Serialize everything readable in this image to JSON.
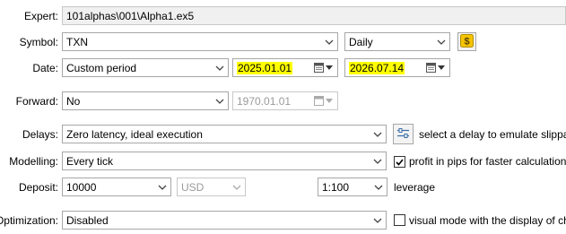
{
  "expert": {
    "label": "Expert:",
    "value": "101alphas\\001\\Alpha1.ex5"
  },
  "symbol": {
    "label": "Symbol:",
    "value": "TXN",
    "timeframe": "Daily",
    "icon": "dollar-icon"
  },
  "date": {
    "label": "Date:",
    "period": "Custom period",
    "from": "2025.01.01",
    "to": "2026.07.14"
  },
  "forward": {
    "label": "Forward:",
    "value": "No",
    "date": "1970.01.01"
  },
  "delays": {
    "label": "Delays:",
    "value": "Zero latency, ideal execution",
    "hint": "select a delay to emulate slippage a"
  },
  "modelling": {
    "label": "Modelling:",
    "value": "Every tick",
    "check_label": "profit in pips for faster calculations",
    "checked": true
  },
  "deposit": {
    "label": "Deposit:",
    "value": "10000",
    "currency": "USD",
    "leverage_value": "1:100",
    "leverage_label": "leverage"
  },
  "optimization": {
    "label": "Optimization:",
    "value": "Disabled",
    "check_label": "visual mode with the display of charts,",
    "checked": false
  },
  "colors": {
    "highlight": "#ffff00",
    "dollar_button": "#f5c400",
    "settings_button_icon": "#3a6ea5"
  }
}
